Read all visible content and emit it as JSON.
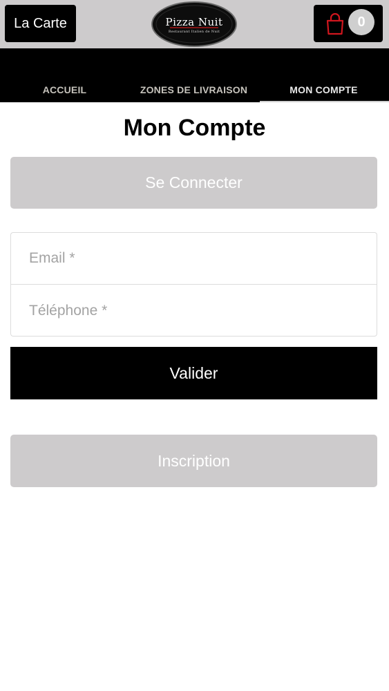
{
  "header": {
    "menu_button_label": "La Carte",
    "logo": {
      "name_text": "Pizza Nuit",
      "tagline_text": "Restaurant Italien de Nuit",
      "icon": "pizza-nuit-logo"
    },
    "cart": {
      "icon": "shopping-bag-icon",
      "count": "0"
    }
  },
  "nav": {
    "items": [
      {
        "label": "ACCUEIL",
        "active": false
      },
      {
        "label": "ZONES DE LIVRAISON",
        "active": false
      },
      {
        "label": "MON COMPTE",
        "active": true
      }
    ]
  },
  "main": {
    "title": "Mon Compte",
    "connect_button_label": "Se Connecter",
    "form": {
      "email_placeholder": "Email *",
      "email_value": "",
      "phone_placeholder": "Téléphone *",
      "phone_value": "",
      "submit_label": "Valider"
    },
    "register_button_label": "Inscription"
  },
  "colors": {
    "header_bg": "#cdcbcc",
    "nav_bg": "#000000",
    "primary_button": "#000000",
    "secondary_button": "#cdcbcc",
    "cart_icon": "#d0161e"
  }
}
